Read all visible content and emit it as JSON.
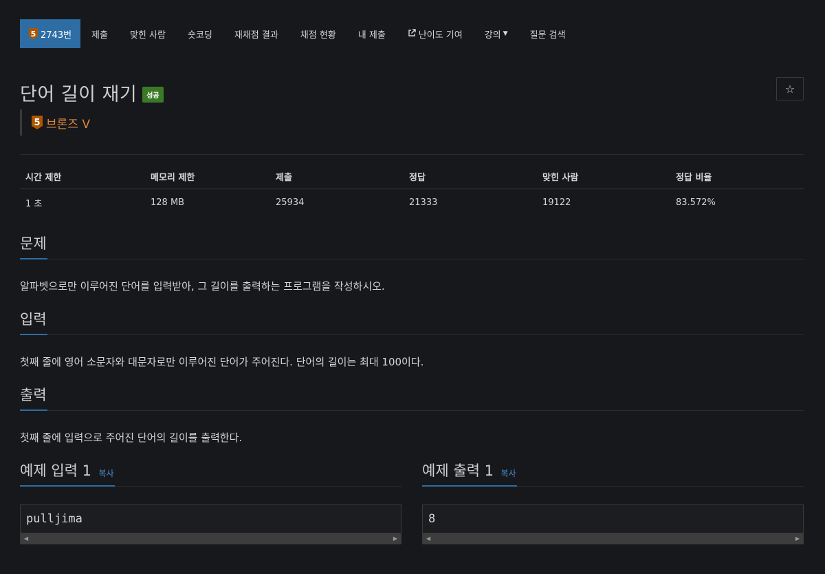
{
  "nav": {
    "problem_tier": "5",
    "problem_number": "2743번",
    "items": [
      "제출",
      "맞힌 사람",
      "숏코딩",
      "재채점 결과",
      "채점 현황",
      "내 제출",
      "난이도 기여",
      "강의",
      "질문 검색"
    ]
  },
  "problem": {
    "title": "단어 길이 재기",
    "status": "성공",
    "star": "☆",
    "tier_number": "5",
    "tier_name": "브론즈 V"
  },
  "info_table": {
    "headers": [
      "시간 제한",
      "메모리 제한",
      "제출",
      "정답",
      "맞힌 사람",
      "정답 비율"
    ],
    "values": [
      "1 초",
      "128 MB",
      "25934",
      "21333",
      "19122",
      "83.572%"
    ]
  },
  "sections": {
    "description_title": "문제",
    "description": "알파벳으로만 이루어진 단어를 입력받아, 그 길이를 출력하는 프로그램을 작성하시오.",
    "input_title": "입력",
    "input": "첫째 줄에 영어 소문자와 대문자로만 이루어진 단어가 주어진다. 단어의 길이는 최대 100이다.",
    "output_title": "출력",
    "output": "첫째 줄에 입력으로 주어진 단어의 길이를 출력한다."
  },
  "samples": {
    "input_title": "예제 입력 1",
    "output_title": "예제 출력 1",
    "copy_label": "복사",
    "input_value": "pulljima",
    "output_value": "8"
  },
  "colors": {
    "accent": "#2e6da4",
    "bronze": "#ad5600",
    "success": "#3a7a27",
    "link": "#4a8fd6"
  }
}
